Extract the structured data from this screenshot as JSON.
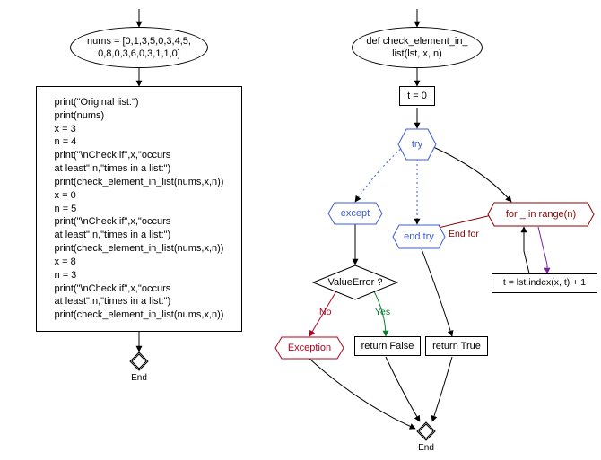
{
  "chart_data": {
    "type": "flowchart",
    "left_flow": {
      "start": "nums = [0,1,3,5,0,3,4,5,\n0,8,0,3,6,0,3,1,1,0]",
      "code": "print(\"Original list:\")\nprint(nums)\nx = 3\nn = 4\nprint(\"\\nCheck if\",x,\"occurs\nat least\",n,\"times in a list:\")\nprint(check_element_in_list(nums,x,n))\nx = 0\nn = 5\nprint(\"\\nCheck if\",x,\"occurs\nat least\",n,\"times in a list:\")\nprint(check_element_in_list(nums,x,n))\nx = 8\nn = 3\nprint(\"\\nCheck if\",x,\"occurs\nat least\",n,\"times in a list:\")\nprint(check_element_in_list(nums,x,n))",
      "end": "End"
    },
    "right_flow": {
      "def": "def check_element_in_\nlist(lst, x, n)",
      "init": "t = 0",
      "try": "try",
      "except": "except",
      "end_try": "end try",
      "value_error": "ValueError ?",
      "no": "No",
      "yes": "Yes",
      "exception": "Exception",
      "return_false": "return False",
      "return_true": "return True",
      "for": "for _ in range(n)",
      "end_for": "End for",
      "loop_body": "t = lst.index(x, t) + 1",
      "end": "End"
    }
  }
}
